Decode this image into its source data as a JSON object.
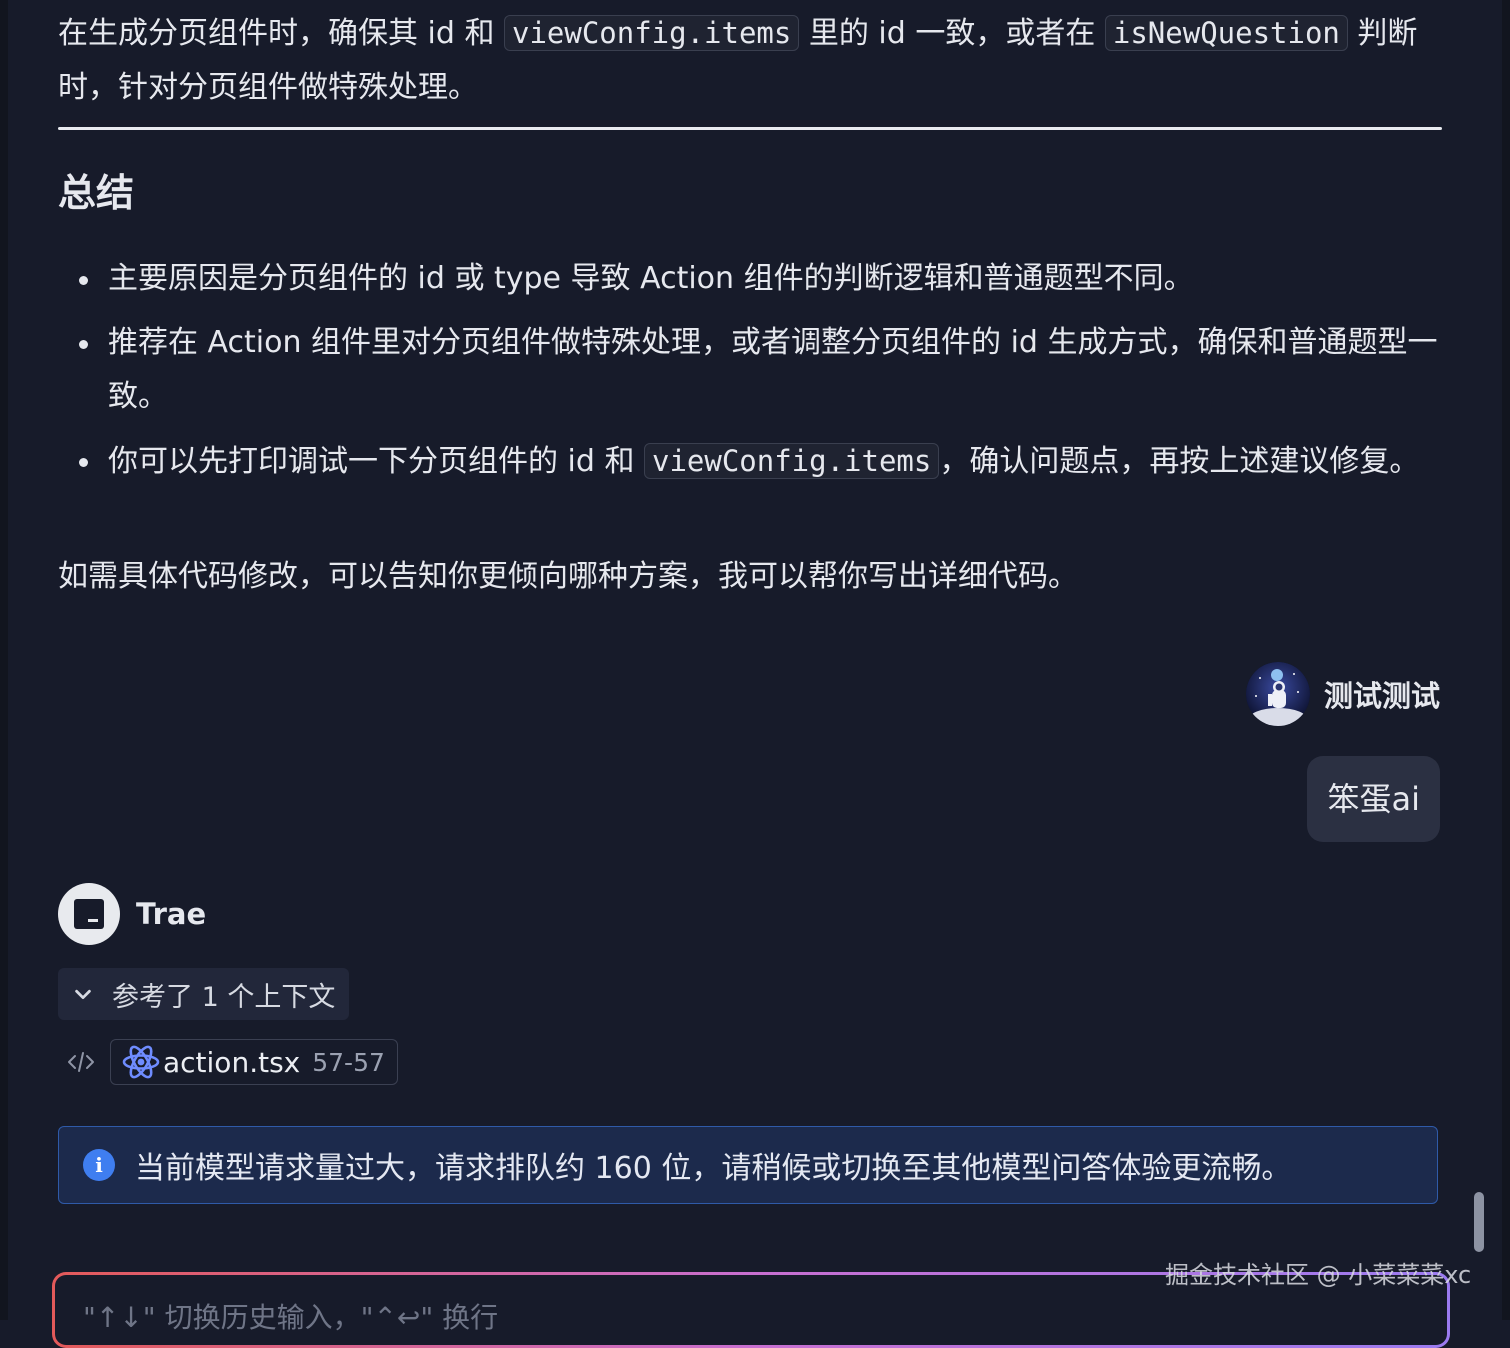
{
  "paragraph1": {
    "part1": "在生成分页组件时，确保其 id 和 ",
    "code1": "viewConfig.items",
    "part2": " 里的 id 一致，或者在 ",
    "code2": "isNewQuestion",
    "part3": " 判断时，针对分页组件做特殊处理。"
  },
  "summary": {
    "heading": "总结",
    "bullets": [
      {
        "text": "主要原因是分页组件的 id 或 type 导致 Action 组件的判断逻辑和普通题型不同。"
      },
      {
        "text": "推荐在 Action 组件里对分页组件做特殊处理，或者调整分页组件的 id 生成方式，确保和普通题型一致。"
      },
      {
        "part1": "你可以先打印调试一下分页组件的 id 和 ",
        "code": "viewConfig.items",
        "part2": "，确认问题点，再按上述建议修复。"
      }
    ],
    "closing": "如需具体代码修改，可以告知你更倾向哪种方案，我可以帮你写出详细代码。"
  },
  "user_message": {
    "name": "测试测试",
    "text": "笨蛋ai"
  },
  "assistant": {
    "name": "Trae",
    "context_toggle": "参考了 1 个上下文",
    "file_name": "action.tsx",
    "file_range": "57-57"
  },
  "notice": {
    "icon_glyph": "i",
    "text": "当前模型请求量过大，请求排队约 160 位，请稍候或切换至其他模型问答体验更流畅。"
  },
  "chat_input": {
    "placeholder": "\"↑↓\" 切换历史输入，\"⌃↩\" 换行"
  },
  "watermark": "掘金技术社区 @ 小菜菜菜xc",
  "icons": {
    "avatar": "astronaut-avatar",
    "trae": "trae-logo-icon",
    "chevron": "chevron-down-icon",
    "code": "code-icon",
    "react": "react-icon",
    "info": "info-icon"
  },
  "colors": {
    "background": "#171b2a",
    "notice_bg": "#1c2a4c",
    "notice_border": "#2f5aa8",
    "info_icon": "#3f7ef0",
    "bubble_bg": "#2b3042"
  }
}
